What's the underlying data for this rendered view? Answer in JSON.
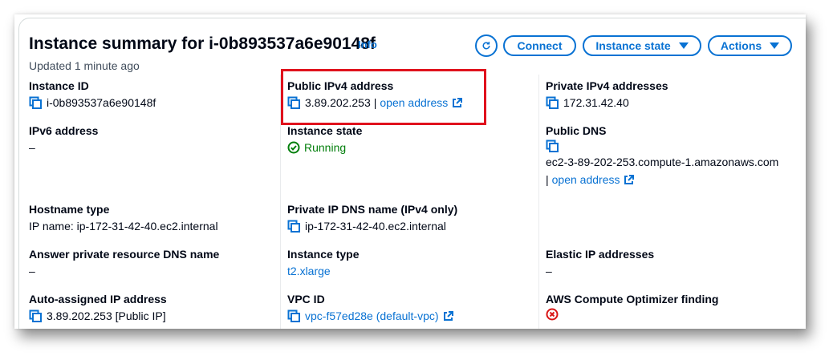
{
  "header": {
    "title": "Instance summary for i-0b893537a6e90148f",
    "info": "Info",
    "updated": "Updated 1 minute ago"
  },
  "buttons": {
    "connect": "Connect",
    "instance_state": "Instance state",
    "actions": "Actions"
  },
  "fields": {
    "instance_id": {
      "label": "Instance ID",
      "value": "i-0b893537a6e90148f"
    },
    "public_ipv4": {
      "label": "Public IPv4 address",
      "value": "3.89.202.253",
      "separator": "|",
      "link": "open address"
    },
    "private_ipv4": {
      "label": "Private IPv4 addresses",
      "value": "172.31.42.40"
    },
    "ipv6": {
      "label": "IPv6 address",
      "value": "–"
    },
    "instance_state": {
      "label": "Instance state",
      "value": "Running"
    },
    "public_dns": {
      "label": "Public DNS",
      "value": "ec2-3-89-202-253.compute-1.amazonaws.com",
      "separator": "|",
      "link": "open address"
    },
    "hostname_type": {
      "label": "Hostname type",
      "value": "IP name: ip-172-31-42-40.ec2.internal"
    },
    "private_ip_dns": {
      "label": "Private IP DNS name (IPv4 only)",
      "value": "ip-172-31-42-40.ec2.internal"
    },
    "answer_dns": {
      "label": "Answer private resource DNS name",
      "value": "–"
    },
    "instance_type": {
      "label": "Instance type",
      "value": "t2.xlarge"
    },
    "elastic_ip": {
      "label": "Elastic IP addresses",
      "value": "–"
    },
    "auto_ip": {
      "label": "Auto-assigned IP address",
      "value": "3.89.202.253 [Public IP]"
    },
    "vpc_id": {
      "label": "VPC ID",
      "value": "vpc-f57ed28e (default-vpc)"
    },
    "optimizer": {
      "label": "AWS Compute Optimizer finding"
    }
  },
  "colors": {
    "link": "#0972d3",
    "success": "#037f0c",
    "error": "#d91515",
    "highlight": "#e0121d"
  }
}
